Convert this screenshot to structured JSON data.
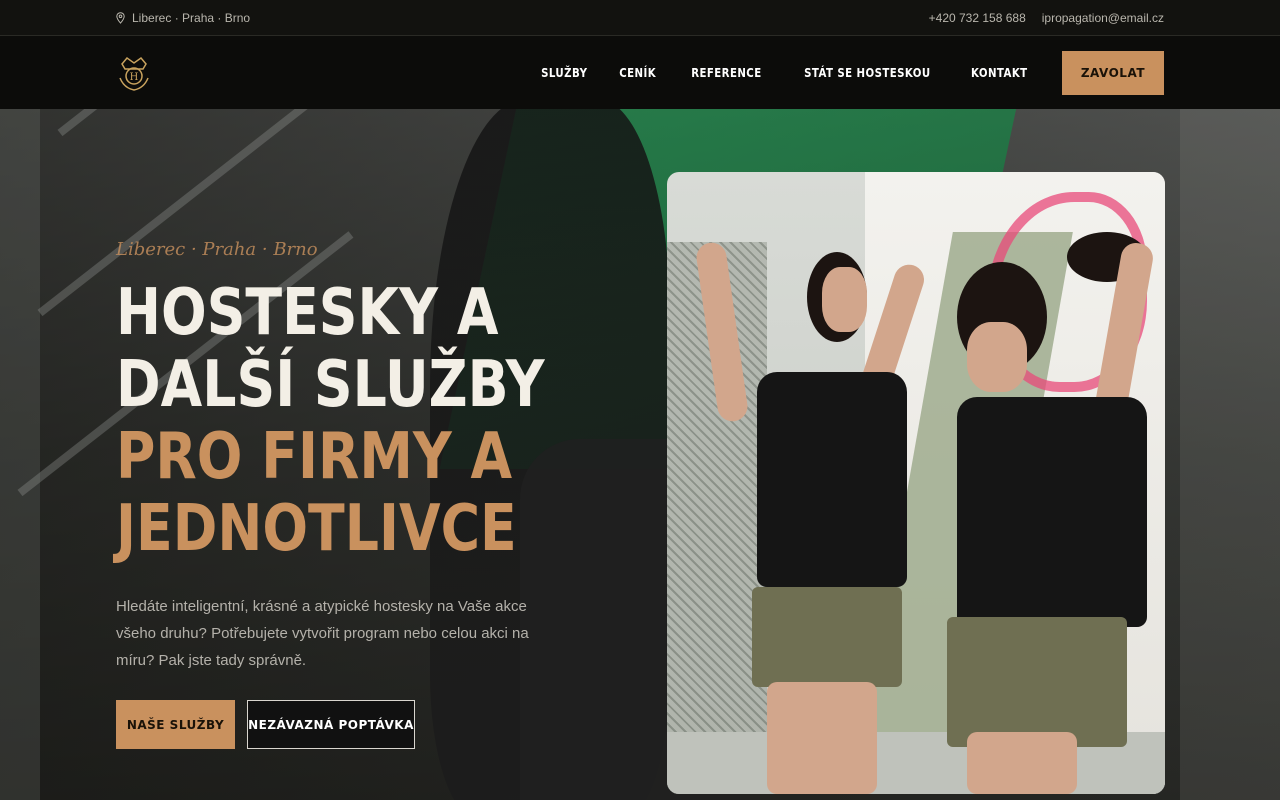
{
  "topbar": {
    "location": "Liberec · Praha · Brno",
    "phone": "+420 732 158 688",
    "email": "ipropagation@email.cz"
  },
  "nav": {
    "items": [
      {
        "label": "SLUŽBY"
      },
      {
        "label": "CENÍK"
      },
      {
        "label": "REFERENCE"
      },
      {
        "label": "STÁT SE HOSTESKOU"
      },
      {
        "label": "KONTAKT"
      }
    ],
    "call_label": "ZAVOLAT"
  },
  "hero": {
    "kicker": "Liberec · Praha · Brno",
    "headline_white": [
      "HOSTESKY A",
      "DALŠÍ SLUŽBY"
    ],
    "headline_gold": [
      "PRO FIRMY A",
      "JEDNOTLIVCE"
    ],
    "lead": "Hledáte inteligentní, krásné a atypické hostesky na Vaše akce všeho druhu? Potřebujete vytvořit program nebo celou akci na míru? Pak jste tady správně.",
    "primary_button": "NAŠE SLUŽBY",
    "secondary_button": "NEZÁVAZNÁ POPTÁVKA"
  },
  "colors": {
    "accent": "#c9915e",
    "dark": "#0c0c0a"
  },
  "icons": {
    "location": "map-pin-icon",
    "logo": "crown-crest-logo"
  }
}
